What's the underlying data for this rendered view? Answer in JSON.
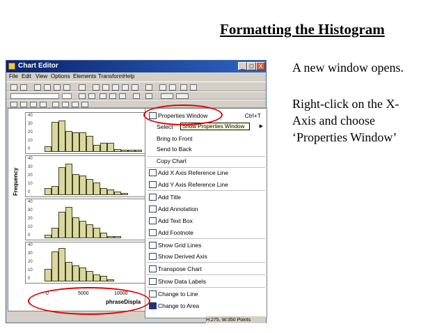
{
  "slide": {
    "title": "Formatting the Histogram",
    "body_lines": [
      "A new window opens.",
      "",
      "Right-click on the X-",
      "Axis and choose",
      "‘Properties Window’"
    ]
  },
  "window": {
    "title": "Chart Editor",
    "controls": [
      "_",
      "□",
      "X"
    ],
    "menu": [
      "File",
      "Edit",
      "View",
      "Options",
      "Elements",
      "Transform",
      "Help"
    ]
  },
  "chart": {
    "ylabel": "Frequency",
    "xlabel": "phraseDispla",
    "xticks": [
      "0",
      "5000",
      "10000"
    ],
    "panels": [
      {
        "yticks": [
          "40",
          "30",
          "20",
          "10",
          "0"
        ],
        "bars": [
          0.15,
          0.85,
          0.9,
          0.6,
          0.55,
          0.55,
          0.45,
          0.2,
          0.25,
          0.25,
          0.08,
          0.05,
          0.05,
          0.05
        ]
      },
      {
        "yticks": [
          "40",
          "30",
          "20",
          "10",
          "0"
        ],
        "bars": [
          0.2,
          0.25,
          0.8,
          0.9,
          0.6,
          0.55,
          0.45,
          0.35,
          0.2,
          0.15,
          0.1,
          0.05
        ]
      },
      {
        "yticks": [
          "40",
          "30",
          "20",
          "10",
          "0"
        ],
        "bars": [
          0.1,
          0.3,
          0.75,
          0.9,
          0.6,
          0.5,
          0.4,
          0.3,
          0.15,
          0.05,
          0.05
        ]
      },
      {
        "yticks": [
          "40",
          "30",
          "20",
          "10",
          "0"
        ],
        "bars": [
          0.35,
          0.85,
          0.95,
          0.55,
          0.45,
          0.4,
          0.3,
          0.2,
          0.15,
          0.05
        ]
      }
    ]
  },
  "context_menu": {
    "items": [
      {
        "label": "Properties Window",
        "shortcut": "Ctrl+T",
        "icon": "properties-icon"
      },
      {
        "label": "Select",
        "submenu": true
      },
      {
        "label": "Bring to Front"
      },
      {
        "label": "Send to Back"
      },
      {
        "label": "Copy Chart"
      },
      {
        "label": "Add X Axis Reference Line",
        "icon": "x-ref-line-icon"
      },
      {
        "label": "Add Y Axis Reference Line",
        "icon": "y-ref-line-icon"
      },
      {
        "label": "Add Title",
        "icon": "title-icon"
      },
      {
        "label": "Add Annotation",
        "icon": "annotation-icon"
      },
      {
        "label": "Add Text Box",
        "icon": "textbox-icon"
      },
      {
        "label": "Add Footnote",
        "icon": "footnote-icon"
      },
      {
        "label": "Show Grid Lines",
        "icon": "grid-icon"
      },
      {
        "label": "Show Derived Axis",
        "icon": "derived-axis-icon"
      },
      {
        "label": "Transpose Chart",
        "icon": "transpose-icon"
      },
      {
        "label": "Show Data Labels",
        "icon": "data-labels-icon"
      },
      {
        "label": "Change to Line",
        "icon": "line-chart-icon"
      },
      {
        "label": "Change to Area",
        "icon": "area-chart-icon"
      }
    ],
    "tooltip": "Show Properties Window"
  },
  "status": "H:275, W:350 Points",
  "colors": {
    "highlight": "#e00000",
    "bar_fill": "#d8d8a0"
  }
}
